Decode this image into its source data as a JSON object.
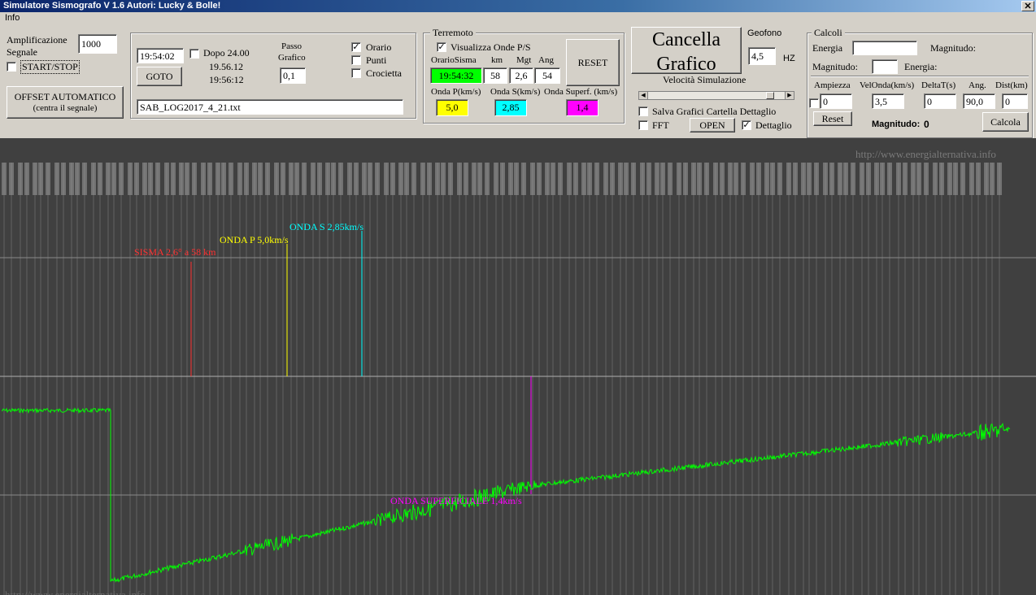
{
  "window": {
    "title": "Simulatore Sismografo V 1.6  Autori: Lucky & Bolle!",
    "close": "✕"
  },
  "menu": {
    "info": "Info"
  },
  "amplification": {
    "label_line1": "Amplificazione",
    "label_line2": "Segnale",
    "value": "1000",
    "start_stop": "START/STOP",
    "offset_line1": "OFFSET AUTOMATICO",
    "offset_line2": "(centra il segnale)"
  },
  "time_panel": {
    "time_value": "19:54:02",
    "dopo_label": "Dopo 24.00",
    "time1": "19.56.12",
    "time2": "19:56:12",
    "goto": "GOTO",
    "passo_line1": "Passo",
    "passo_line2": "Grafico",
    "passo_value": "0,1",
    "file_value": "SAB_LOG2017_4_21.txt",
    "orario": "Orario",
    "punti": "Punti",
    "crocietta": "Crocietta",
    "orario_checked": true,
    "punti_checked": false,
    "crocietta_checked": false
  },
  "terremoto": {
    "legend": "Terremoto",
    "visualizza": "Visualizza Onde P/S",
    "visualizza_checked": true,
    "col_orario": "OrarioSisma",
    "col_km": "km",
    "col_mgt": "Mgt",
    "col_ang": "Ang",
    "orario_value": "19:54:32",
    "km_value": "58",
    "mgt_value": "2,6",
    "ang_value": "54",
    "reset": "RESET",
    "onda_p_label": "Onda P(km/s)",
    "onda_s_label": "Onda S(km/s)",
    "onda_sup_label": "Onda Superf. (km/s)",
    "onda_p_value": "5,0",
    "onda_s_value": "2,85",
    "onda_sup_value": "1,4",
    "color_green": "#00ff00",
    "color_yellow": "#ffff00",
    "color_cyan": "#00ffff",
    "color_magenta": "#ff00ff"
  },
  "graph_controls": {
    "cancella_line1": "Cancella",
    "cancella_line2": "Grafico",
    "geofono": "Geofono",
    "geofono_value": "4,5",
    "hz": "HZ",
    "velocita": "Velocità Simulazione",
    "velocita_level": 0.92,
    "salva": "Salva Grafici Cartella Dettaglio",
    "fft": "FFT",
    "open": "OPEN",
    "dettaglio": "Dettaglio",
    "salva_checked": false,
    "fft_checked": false,
    "dettaglio_checked": true
  },
  "calcoli": {
    "legend": "Calcoli",
    "energia": "Energia",
    "magnitudo": "Magnitudo:",
    "magnitudo2": "Magnitudo:",
    "energia2": "Energia:",
    "energia_value": "",
    "magnitudo_value": "",
    "ampiezza": "Ampiezza",
    "velonda": "VelOnda(km/s)",
    "deltat": "DeltaT(s)",
    "ang": "Ang.",
    "dist": "Dist(km)",
    "ampiezza_value": "0",
    "velonda_value": "3,5",
    "deltat_value": "0",
    "ang_value": "90,0",
    "dist_value": "0",
    "reset": "Reset",
    "magnitudo_result_label": "Magnitudo:",
    "magnitudo_result_value": "0",
    "calcola": "Calcola"
  },
  "plot": {
    "watermark_top": "http://www.energialternativa.info",
    "watermark_bottom": "http://www.energialternativa.info",
    "bg_color": "#404040",
    "signal_color": "#00ff00",
    "markers": [
      {
        "label": "SISMA 2,6° a 58 km",
        "color": "#ff3030"
      },
      {
        "label": "ONDA P 5,0km/s",
        "color": "#ffff00"
      },
      {
        "label": "ONDA S 2,85km/s",
        "color": "#00ffff"
      },
      {
        "label": "ONDA SUPERFICIALE 1,4km/s",
        "color": "#ff00ff"
      }
    ]
  }
}
